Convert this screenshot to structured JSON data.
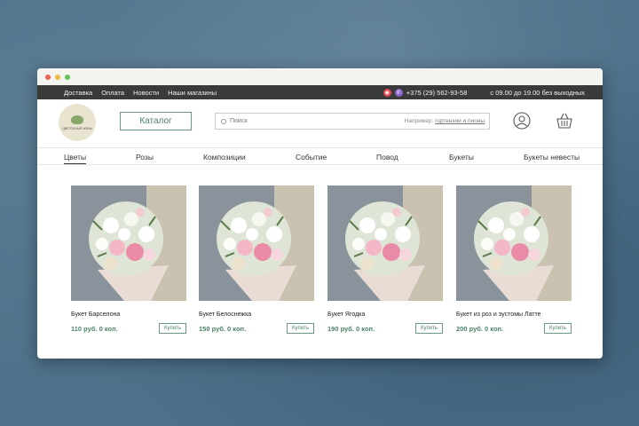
{
  "colors": {
    "accent": "#4d8266",
    "topbar": "#3a3a3a",
    "background": "#4f7189"
  },
  "topbar": {
    "nav": [
      "Доставка",
      "Оплата",
      "Новости",
      "Наши магазины"
    ],
    "phone": "+375 (29) 562-93-58",
    "hours": "с 09.00 до 19.00 без выходных",
    "social_icons": [
      "instagram-icon",
      "viber-icon"
    ]
  },
  "header": {
    "logo_text": "ЦВЕТОЧНЫЙ ЖЕНЬ",
    "catalog_label": "Каталог",
    "search": {
      "placeholder": "Поиск",
      "hint_prefix": "Например:",
      "hint_example": "гортензии и пионы"
    },
    "icons": [
      "user-icon",
      "cart-icon"
    ]
  },
  "categories": [
    "Цветы",
    "Розы",
    "Композиции",
    "Событие",
    "Повод",
    "Букеты",
    "Букеты невесты"
  ],
  "active_category": "Цветы",
  "products": [
    {
      "name": "Букет Барселона",
      "price": "110 руб. 0 коп.",
      "buy": "Купить"
    },
    {
      "name": "Букет Белоснежка",
      "price": "150 руб. 0 коп.",
      "buy": "Купить"
    },
    {
      "name": "Букет Ягодка",
      "price": "190 руб. 0 коп.",
      "buy": "Купить"
    },
    {
      "name": "Букет из роз и эустомы Латте",
      "price": "200 руб. 0 коп.",
      "buy": "Купить"
    }
  ]
}
